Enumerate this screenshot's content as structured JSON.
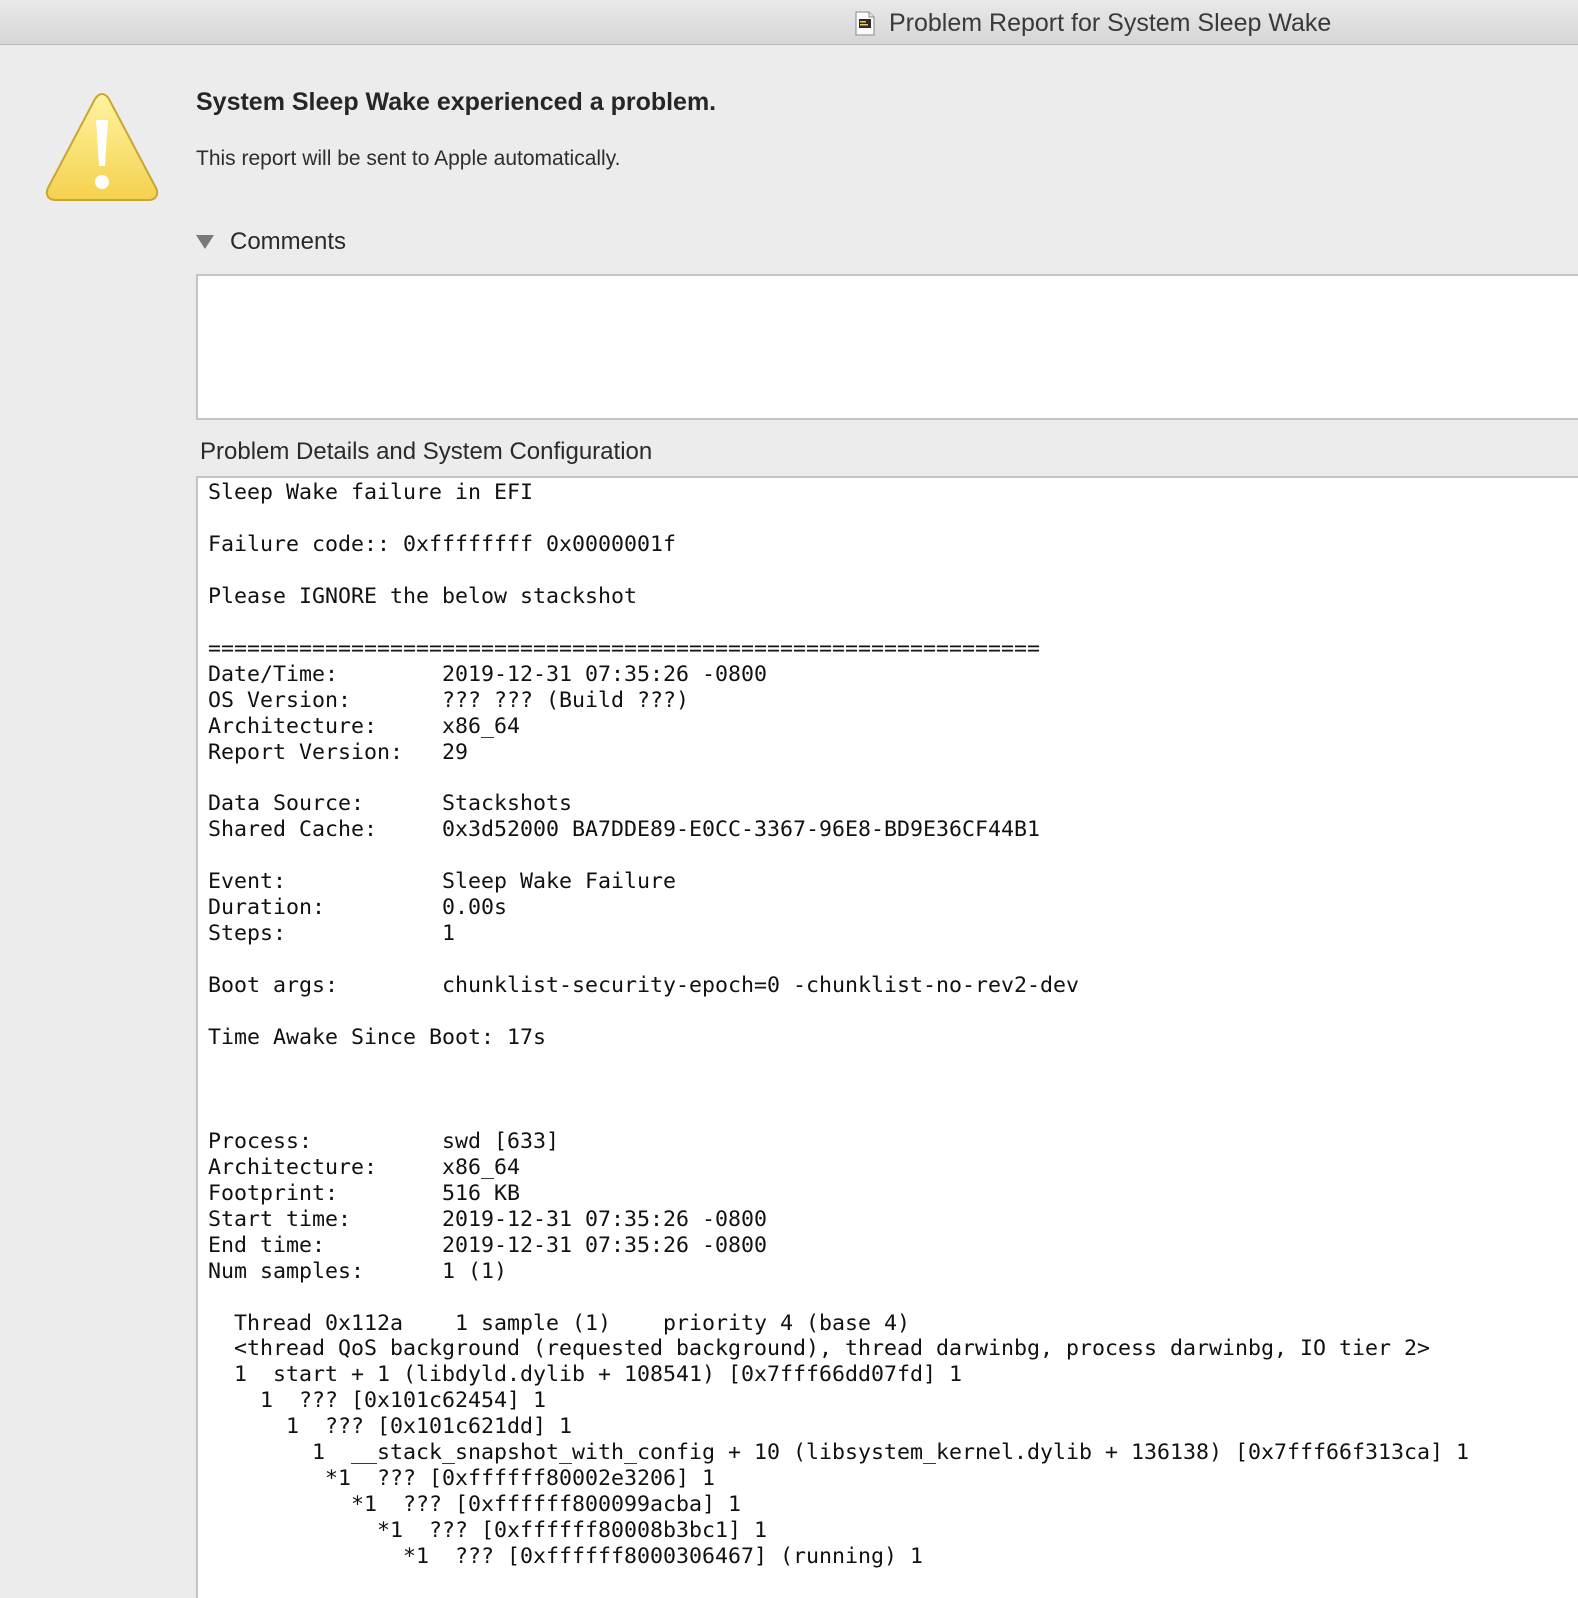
{
  "window": {
    "title": "Problem Report for System Sleep Wake",
    "icon": "console-document-icon"
  },
  "alert": {
    "icon": "warning-icon",
    "headline": "System Sleep Wake experienced a problem.",
    "subline": "This report will be sent to Apple automatically."
  },
  "comments": {
    "label": "Comments",
    "value": "",
    "placeholder": ""
  },
  "details": {
    "label": "Problem Details and System Configuration",
    "lines": [
      "Sleep Wake failure in EFI",
      "",
      "Failure code:: 0xffffffff 0x0000001f",
      "",
      "Please IGNORE the below stackshot",
      "",
      "================================================================",
      "Date/Time:        2019-12-31 07:35:26 -0800",
      "OS Version:       ??? ??? (Build ???)",
      "Architecture:     x86_64",
      "Report Version:   29",
      "",
      "Data Source:      Stackshots",
      "Shared Cache:     0x3d52000 BA7DDE89-E0CC-3367-96E8-BD9E36CF44B1",
      "",
      "Event:            Sleep Wake Failure",
      "Duration:         0.00s",
      "Steps:            1",
      "",
      "Boot args:        chunklist-security-epoch=0 -chunklist-no-rev2-dev",
      "",
      "Time Awake Since Boot: 17s",
      "",
      "",
      "",
      "Process:          swd [633]",
      "Architecture:     x86_64",
      "Footprint:        516 KB",
      "Start time:       2019-12-31 07:35:26 -0800",
      "End time:         2019-12-31 07:35:26 -0800",
      "Num samples:      1 (1)",
      "",
      "  Thread 0x112a    1 sample (1)    priority 4 (base 4)",
      "  <thread QoS background (requested background), thread darwinbg, process darwinbg, IO tier 2>",
      "  1  start + 1 (libdyld.dylib + 108541) [0x7fff66dd07fd] 1",
      "    1  ??? [0x101c62454] 1",
      "      1  ??? [0x101c621dd] 1",
      "        1  __stack_snapshot_with_config + 10 (libsystem_kernel.dylib + 136138) [0x7fff66f313ca] 1",
      "         *1  ??? [0xffffff80002e3206] 1",
      "           *1  ??? [0xffffff800099acba] 1",
      "             *1  ??? [0xffffff80008b3bc1] 1",
      "               *1  ??? [0xffffff8000306467] (running) 1"
    ]
  }
}
